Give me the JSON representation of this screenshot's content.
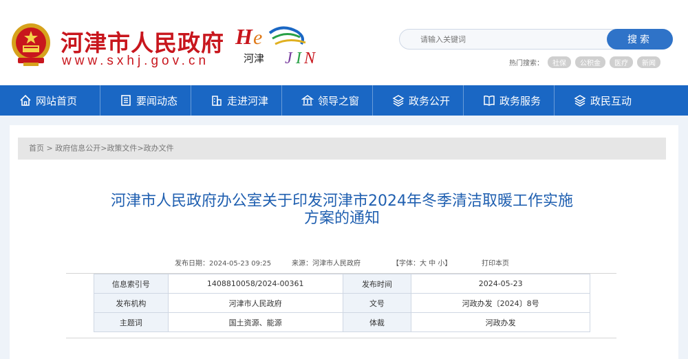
{
  "header": {
    "site_name": "河津市人民政府",
    "site_url": "www.sxhj.gov.cn",
    "brand_text": "河津",
    "search_placeholder": "请输入关键词",
    "search_button": "搜索",
    "hot_label": "热门搜索：",
    "hot_words": [
      "社保",
      "公积金",
      "医疗",
      "新闻"
    ]
  },
  "nav": {
    "items": [
      {
        "label": "网站首页",
        "icon": "home-icon"
      },
      {
        "label": "要闻动态",
        "icon": "news-icon"
      },
      {
        "label": "走进河津",
        "icon": "building-icon"
      },
      {
        "label": "领导之窗",
        "icon": "bank-icon"
      },
      {
        "label": "政务公开",
        "icon": "layers-icon"
      },
      {
        "label": "政务服务",
        "icon": "book-icon"
      },
      {
        "label": "政民互动",
        "icon": "layers-icon"
      }
    ]
  },
  "breadcrumb": [
    "首页",
    "政府信息公开",
    "政策文件",
    "政办文件"
  ],
  "article": {
    "title_line1": "河津市人民政府办公室关于印发河津市2024年冬季清洁取暖工作实施",
    "title_line2": "方案的通知",
    "publish_date_label": "发布日期：",
    "publish_date": "2024-05-23 09:25",
    "source_label": "来源：",
    "source": "河津市人民政府",
    "font_size_label": "【字体：大 中 小】",
    "print_label": "打印本页"
  },
  "info_table": {
    "rows": [
      {
        "k1": "信息索引号",
        "v1": "1408810058/2024-00361",
        "k2": "发布时间",
        "v2": "2024-05-23"
      },
      {
        "k1": "发布机构",
        "v1": "河津市人民政府",
        "k2": "文号",
        "v2": "河政办发〔2024〕8号"
      },
      {
        "k1": "主题词",
        "v1": "国土资源、能源",
        "k2": "体裁",
        "v2": "河政办发"
      }
    ]
  },
  "colors": {
    "brand_red": "#c8161d",
    "nav_blue": "#1a67c4",
    "title_blue": "#1f5fb0",
    "search_blue": "#2f73c8"
  }
}
